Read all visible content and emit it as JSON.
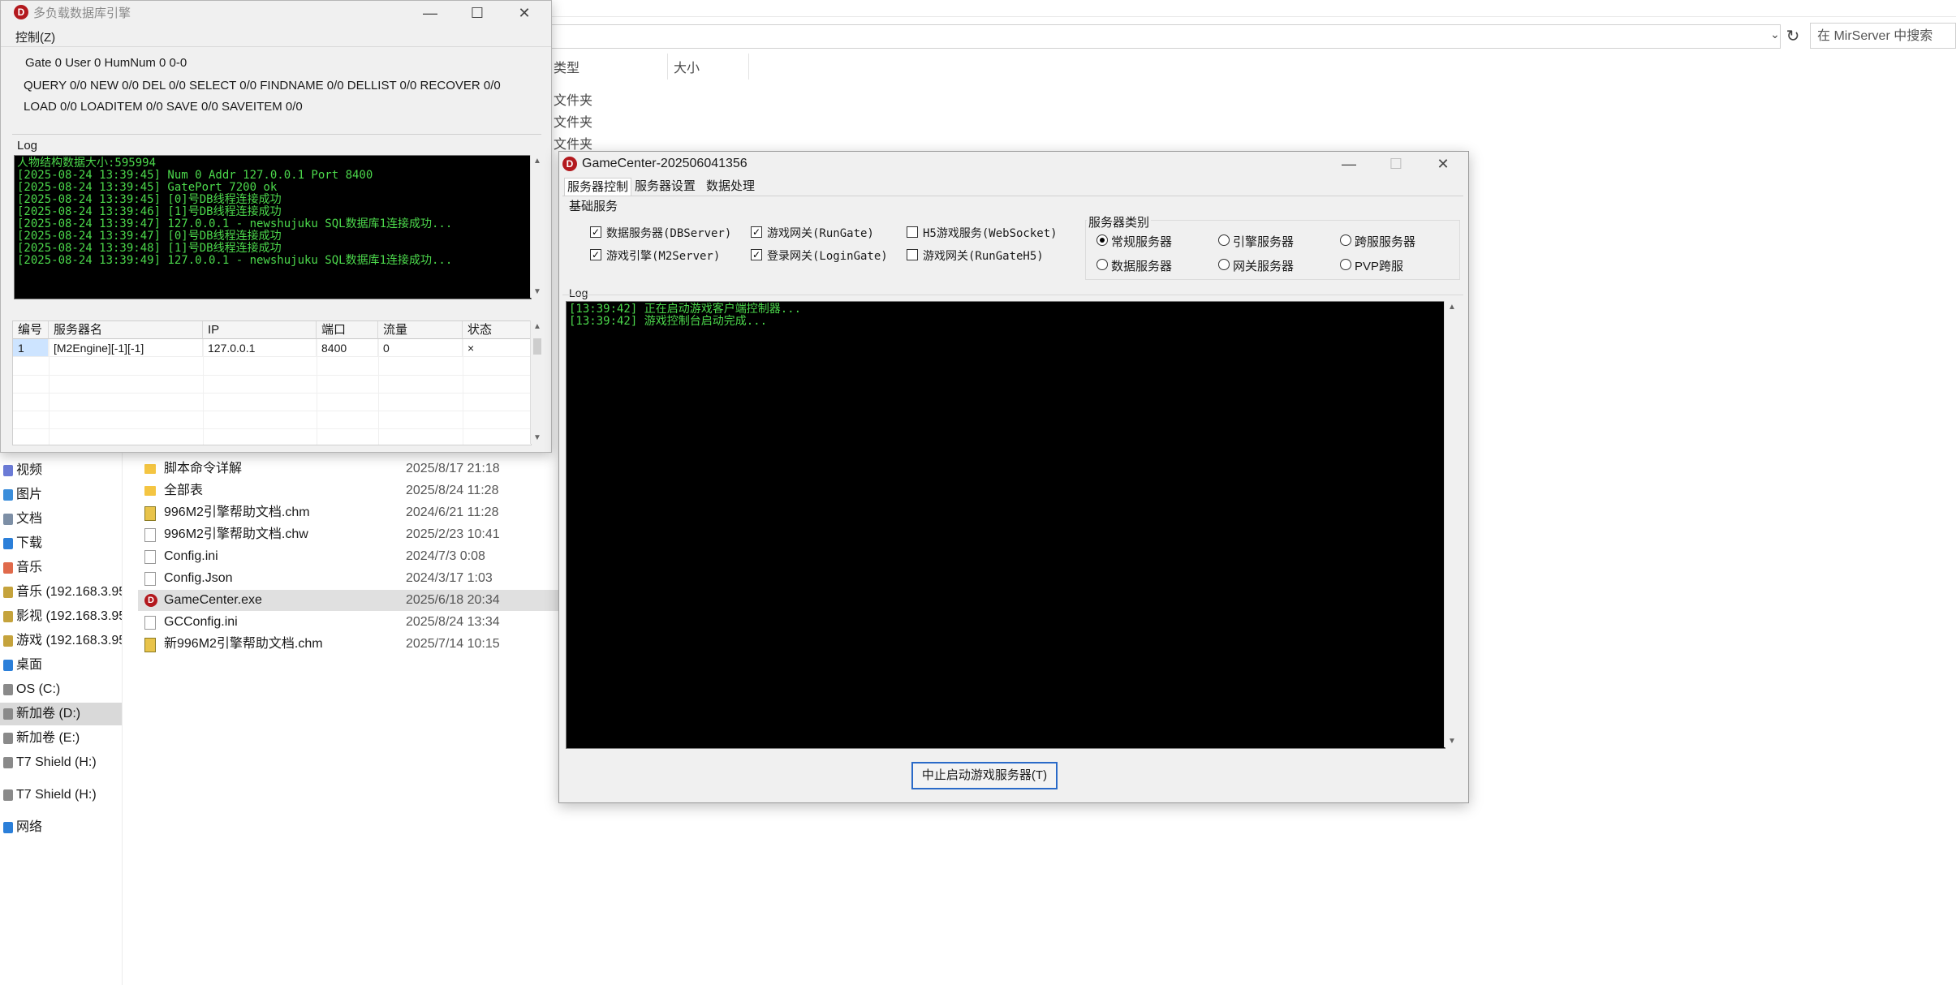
{
  "explorer": {
    "search_placeholder": "在 MirServer 中搜索",
    "columns": {
      "type": "类型",
      "size": "大小"
    },
    "type_cells": [
      "文件夹",
      "文件夹",
      "文件夹"
    ],
    "nav_items": [
      {
        "label": "视频",
        "icon": "video-icon",
        "color": "#6b7bd6"
      },
      {
        "label": "图片",
        "icon": "image-icon",
        "color": "#3b8edb"
      },
      {
        "label": "文档",
        "icon": "document-icon",
        "color": "#7d8fa6"
      },
      {
        "label": "下载",
        "icon": "download-icon",
        "color": "#2b7fd9"
      },
      {
        "label": "音乐",
        "icon": "music-icon",
        "color": "#e06a4b"
      },
      {
        "label": "音乐 (192.168.3.95",
        "icon": "network-drive-icon",
        "color": "#c5a33c"
      },
      {
        "label": "影视 (192.168.3.95",
        "icon": "network-drive-icon",
        "color": "#c5a33c"
      },
      {
        "label": "游戏 (192.168.3.95",
        "icon": "network-drive-icon",
        "color": "#c5a33c"
      },
      {
        "label": "桌面",
        "icon": "desktop-icon",
        "color": "#2b7fd9"
      },
      {
        "label": "OS (C:)",
        "icon": "drive-icon",
        "color": "#8a8a8a"
      },
      {
        "label": "新加卷 (D:)",
        "icon": "drive-icon",
        "color": "#8a8a8a",
        "selected": true
      },
      {
        "label": "新加卷 (E:)",
        "icon": "drive-icon",
        "color": "#8a8a8a"
      },
      {
        "label": "T7 Shield (H:)",
        "icon": "drive-icon",
        "color": "#8a8a8a"
      },
      {
        "label": "T7 Shield (H:)",
        "icon": "drive-icon",
        "color": "#8a8a8a"
      },
      {
        "label": "网络",
        "icon": "network-icon",
        "color": "#2b7fd9"
      }
    ],
    "files": [
      {
        "name": "脚本命令详解",
        "date": "2025/8/17 21:18",
        "kind": "folder"
      },
      {
        "name": "全部表",
        "date": "2025/8/24 11:28",
        "kind": "folder"
      },
      {
        "name": "996M2引擎帮助文档.chm",
        "date": "2024/6/21 11:28",
        "kind": "chm"
      },
      {
        "name": "996M2引擎帮助文档.chw",
        "date": "2025/2/23 10:41",
        "kind": "doc"
      },
      {
        "name": "Config.ini",
        "date": "2024/7/3 0:08",
        "kind": "doc"
      },
      {
        "name": "Config.Json",
        "date": "2024/3/17 1:03",
        "kind": "doc"
      },
      {
        "name": "GameCenter.exe",
        "date": "2025/6/18 20:34",
        "kind": "exe",
        "selected": true
      },
      {
        "name": "GCConfig.ini",
        "date": "2025/8/24 13:34",
        "kind": "doc"
      },
      {
        "name": "新996M2引擎帮助文档.chm",
        "date": "2025/7/14 10:15",
        "kind": "chm"
      }
    ]
  },
  "db_window": {
    "title": "多负载数据库引擎",
    "icon_letter": "D",
    "menu": "控制(Z)",
    "stats": [
      "Gate 0 User 0 HumNum 0 0-0",
      "QUERY 0/0 NEW 0/0 DEL 0/0 SELECT 0/0 FINDNAME 0/0 DELLIST 0/0 RECOVER 0/0",
      "LOAD 0/0 LOADITEM 0/0 SAVE 0/0 SAVEITEM 0/0"
    ],
    "log_label": "Log",
    "log_lines": [
      "人物结构数据大小:595994",
      "[2025-08-24 13:39:45] Num 0 Addr 127.0.0.1 Port 8400",
      "[2025-08-24 13:39:45] GatePort 7200 ok",
      "[2025-08-24 13:39:45] [0]号DB线程连接成功",
      "[2025-08-24 13:39:46] [1]号DB线程连接成功",
      "[2025-08-24 13:39:47] 127.0.0.1 - newshujuku SQL数据库1连接成功...",
      "[2025-08-24 13:39:47] [0]号DB线程连接成功",
      "[2025-08-24 13:39:48] [1]号DB线程连接成功",
      "[2025-08-24 13:39:49] 127.0.0.1 - newshujuku SQL数据库1连接成功..."
    ],
    "grid": {
      "columns": [
        "编号",
        "服务器名",
        "IP",
        "端口",
        "流量",
        "状态"
      ],
      "rows": [
        [
          "1",
          "[M2Engine][-1][-1]",
          "127.0.0.1",
          "8400",
          "0",
          "×"
        ]
      ]
    }
  },
  "gc_window": {
    "title": "GameCenter-202506041356",
    "icon_letter": "D",
    "tabs": [
      "服务器控制",
      "服务器设置",
      "数据处理"
    ],
    "basic_group": "基础服务",
    "checkboxes": [
      {
        "label": "数据服务器(DBServer)",
        "checked": true
      },
      {
        "label": "游戏网关(RunGate)",
        "checked": true
      },
      {
        "label": "H5游戏服务(WebSocket)",
        "checked": false
      },
      {
        "label": "游戏引擎(M2Server)",
        "checked": true
      },
      {
        "label": "登录网关(LoginGate)",
        "checked": true
      },
      {
        "label": "游戏网关(RunGateH5)",
        "checked": false
      }
    ],
    "server_type_group": "服务器类别",
    "radios": [
      {
        "label": "常规服务器",
        "selected": true
      },
      {
        "label": "引擎服务器",
        "selected": false
      },
      {
        "label": "跨服服务器",
        "selected": false
      },
      {
        "label": "数据服务器",
        "selected": false
      },
      {
        "label": "网关服务器",
        "selected": false
      },
      {
        "label": "PVP跨服",
        "selected": false
      }
    ],
    "log_label": "Log",
    "log_lines": [
      "[13:39:42] 正在启动游戏客户端控制器...",
      "[13:39:42] 游戏控制台启动完成..."
    ],
    "stop_button": "中止启动游戏服务器(T)"
  },
  "colors": {
    "log_text": "#4cd94c",
    "log_bg": "#000000",
    "accent": "#2a6ac8"
  }
}
